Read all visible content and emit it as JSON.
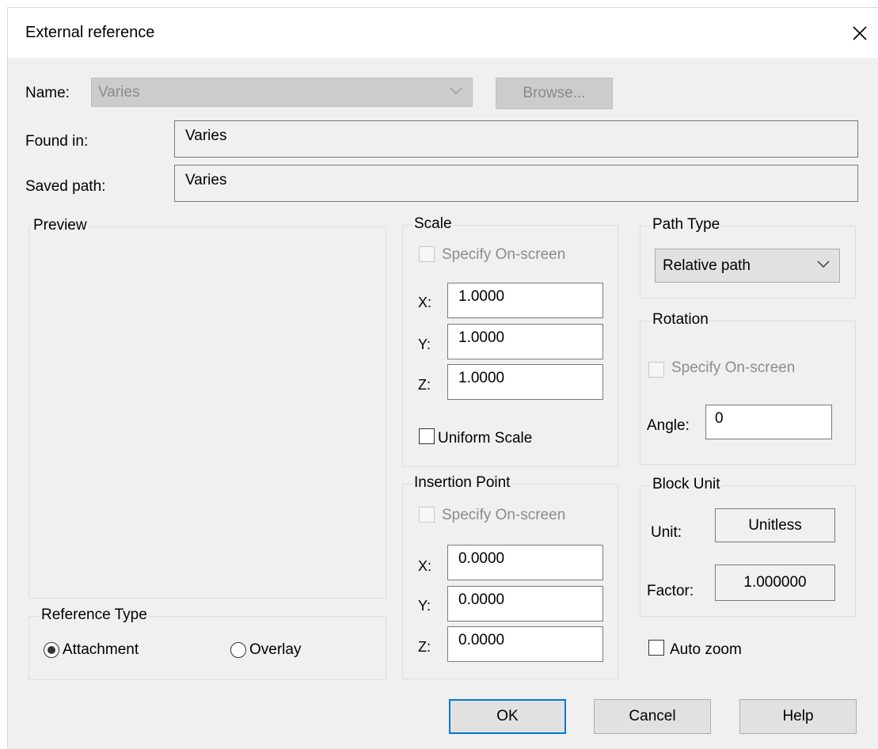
{
  "window": {
    "title": "External reference"
  },
  "name_field": {
    "label": "Name:",
    "value": "Varies"
  },
  "browse_button": "Browse...",
  "found_in": {
    "label": "Found in:",
    "value": "Varies"
  },
  "saved_path": {
    "label": "Saved path:",
    "value": "Varies"
  },
  "preview": {
    "label": "Preview"
  },
  "reference_type": {
    "label": "Reference Type",
    "attachment": "Attachment",
    "overlay": "Overlay",
    "selected": "Attachment"
  },
  "scale": {
    "label": "Scale",
    "specify_on_screen": "Specify On-screen",
    "x_label": "X:",
    "x": "1.0000",
    "y_label": "Y:",
    "y": "1.0000",
    "z_label": "Z:",
    "z": "1.0000",
    "uniform_scale": "Uniform Scale"
  },
  "insertion_point": {
    "label": "Insertion Point",
    "specify_on_screen": "Specify On-screen",
    "x_label": "X:",
    "x": "0.0000",
    "y_label": "Y:",
    "y": "0.0000",
    "z_label": "Z:",
    "z": "0.0000"
  },
  "path_type": {
    "label": "Path Type",
    "value": "Relative path"
  },
  "rotation": {
    "label": "Rotation",
    "specify_on_screen": "Specify On-screen",
    "angle_label": "Angle:",
    "angle": "0"
  },
  "block_unit": {
    "label": "Block Unit",
    "unit_label": "Unit:",
    "unit": "Unitless",
    "factor_label": "Factor:",
    "factor": "1.000000"
  },
  "auto_zoom": "Auto zoom",
  "buttons": {
    "ok": "OK",
    "cancel": "Cancel",
    "help": "Help"
  },
  "icons": {
    "close": "close-icon",
    "chevron": "chevron-down-icon"
  },
  "colors": {
    "default_button_border": "#0078d7",
    "dialog_bg": "#f0f0f0"
  }
}
